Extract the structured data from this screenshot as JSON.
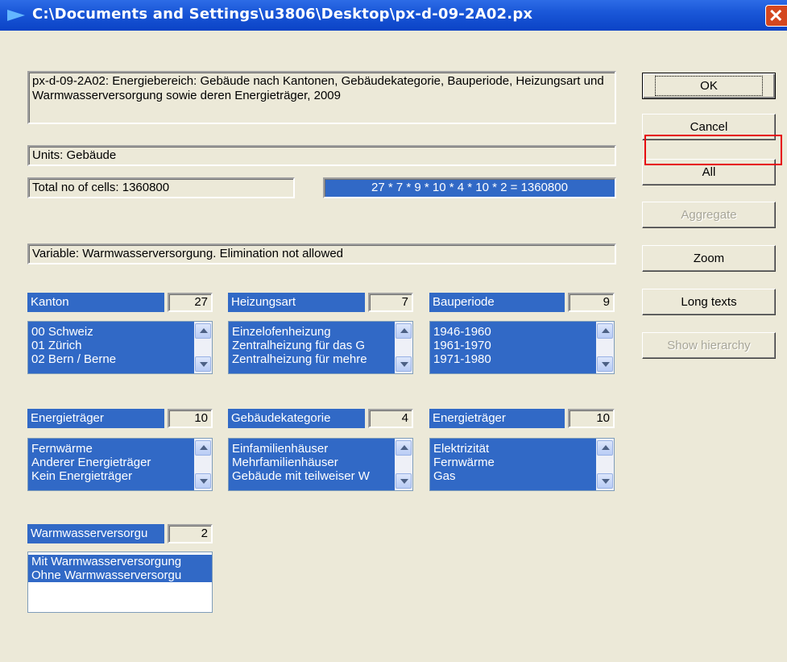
{
  "window": {
    "title": "C:\\Documents and Settings\\u3806\\Desktop\\px-d-09-2A02.px",
    "close_label": "✕"
  },
  "description": "px-d-09-2A02: Energiebereich: Gebäude nach Kantonen, Gebäudekategorie, Bauperiode, Heizungsart und Warmwasserversorgung sowie deren Energieträger, 2009",
  "units": "Units: Gebäude",
  "total_cells": "Total no of cells:  1360800",
  "cells_formula": "27 * 7 * 9 * 10 * 4 * 10 * 2  =  1360800",
  "variable_info": "Variable: Warmwasserversorgung. Elimination not allowed",
  "buttons": {
    "ok": "OK",
    "cancel": "Cancel",
    "all": "All",
    "aggregate": "Aggregate",
    "zoom": "Zoom",
    "long_texts": "Long texts",
    "show_hierarchy": "Show hierarchy"
  },
  "variables": [
    {
      "name": "Kanton",
      "count": "27",
      "items": [
        "00 Schweiz",
        "01 Zürich",
        "02 Bern / Berne"
      ]
    },
    {
      "name": "Heizungsart",
      "count": "7",
      "items": [
        "Einzelofenheizung",
        "Zentralheizung für das G",
        "Zentralheizung für mehre"
      ]
    },
    {
      "name": "Bauperiode",
      "count": "9",
      "items": [
        "1946-1960",
        "1961-1970",
        "1971-1980"
      ]
    },
    {
      "name": "Energieträger",
      "count": "10",
      "items": [
        "Fernwärme",
        "Anderer Energieträger",
        "Kein Energieträger"
      ]
    },
    {
      "name": "Gebäudekategorie",
      "count": "4",
      "items": [
        "Einfamilienhäuser",
        "Mehrfamilienhäuser",
        "Gebäude mit teilweiser W"
      ]
    },
    {
      "name": "Energieträger",
      "count": "10",
      "items": [
        "Elektrizität",
        "Fernwärme",
        "Gas"
      ]
    },
    {
      "name": "Warmwasserversorgu",
      "count": "2",
      "items": [
        "Mit Warmwasserversorgung",
        "Ohne Warmwasserversorgu"
      ]
    }
  ]
}
